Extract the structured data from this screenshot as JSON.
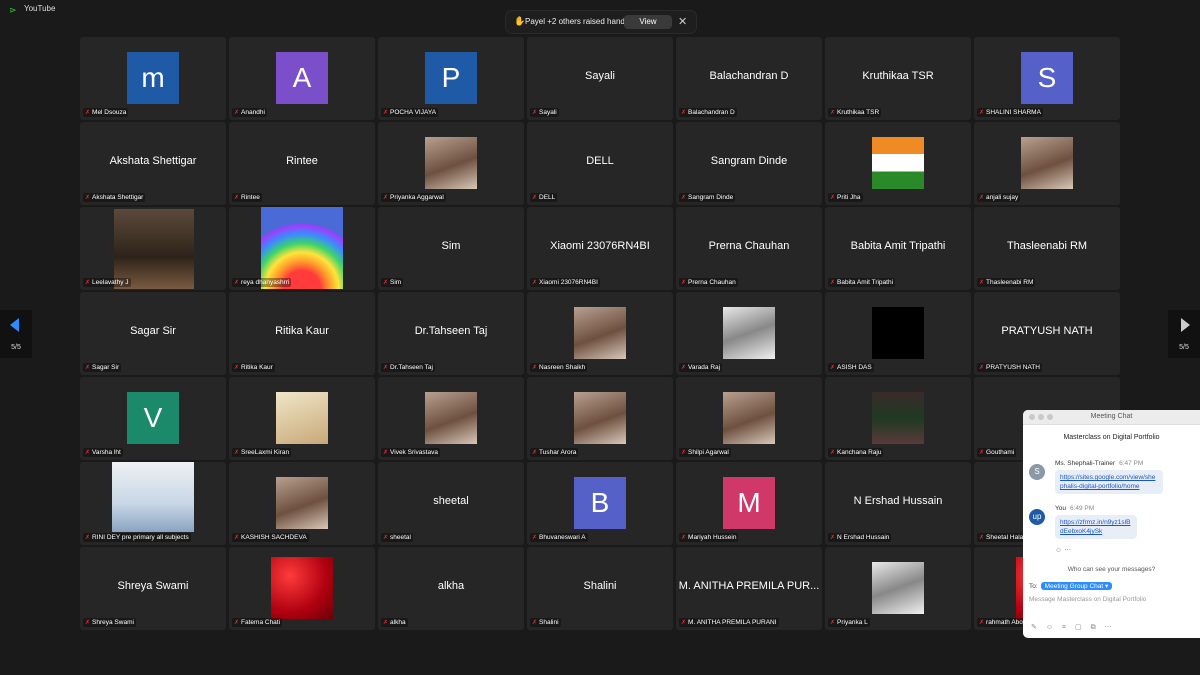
{
  "app": {
    "title": "YouTube",
    "icon": "app-icon"
  },
  "notification": {
    "text": "Payel +2 others raised hands",
    "view_label": "View",
    "close_glyph": "✕"
  },
  "navigation": {
    "prev_page": "5/5",
    "next_page": "5/5"
  },
  "participants": [
    {
      "big": "",
      "avatar": "m",
      "color": "#1f5aa6",
      "label": "Mel Dsouza"
    },
    {
      "big": "",
      "avatar": "A",
      "color": "#7b4fc9",
      "label": "Anandhi"
    },
    {
      "big": "",
      "avatar": "P",
      "color": "#1f5aa6",
      "label": "POCHA VIJAYA"
    },
    {
      "big": "Sayali",
      "label": "Sayali"
    },
    {
      "big": "Balachandran D",
      "label": "Balachandran D"
    },
    {
      "big": "Kruthikaa TSR",
      "label": "Kruthikaa TSR"
    },
    {
      "big": "",
      "avatar": "S",
      "color": "#5560c8",
      "label": "SHALINI SHARMA"
    },
    {
      "big": "Akshata Shettigar",
      "label": "Akshata Shettigar"
    },
    {
      "big": "Rintee",
      "label": "Rintee"
    },
    {
      "big": "",
      "photo": "person",
      "label": "Priyanka Aggarwal"
    },
    {
      "big": "DELL",
      "label": "DELL"
    },
    {
      "big": "Sangram Dinde",
      "label": "Sangram Dinde"
    },
    {
      "big": "",
      "photo": "flag",
      "label": "Priti Jha"
    },
    {
      "big": "",
      "photo": "person",
      "label": "anjali sujay"
    },
    {
      "big": "",
      "photo": "person-wide",
      "label": "Leelavathy J"
    },
    {
      "big": "",
      "photo": "rainbow",
      "label": "reya dhanyashrri"
    },
    {
      "big": "Sim",
      "label": "Sim"
    },
    {
      "big": "Xiaomi 23076RN4BI",
      "label": "Xiaomi 23076RN4BI"
    },
    {
      "big": "Prerna Chauhan",
      "label": "Prerna Chauhan"
    },
    {
      "big": "Babita Amit Tripathi",
      "label": "Babita Amit Tripathi"
    },
    {
      "big": "Thasleenabi RM",
      "label": "Thasleenabi RM"
    },
    {
      "big": "Sagar Sir",
      "label": "Sagar Sir"
    },
    {
      "big": "Ritika Kaur",
      "label": "Ritika Kaur"
    },
    {
      "big": "Dr.Tahseen Taj",
      "label": "Dr.Tahseen Taj"
    },
    {
      "big": "",
      "photo": "person",
      "label": "Nasreen Shaikh"
    },
    {
      "big": "",
      "photo": "person-light",
      "label": "Varada Raj"
    },
    {
      "big": "",
      "photo": "black",
      "label": "ASISH DAS"
    },
    {
      "big": "PRATYUSH NATH",
      "label": "PRATYUSH NATH"
    },
    {
      "big": "",
      "avatar": "V",
      "color": "#1a8a6a",
      "label": "Varsha lht"
    },
    {
      "big": "",
      "photo": "logo",
      "label": "SreeLaxmi Kiran"
    },
    {
      "big": "",
      "photo": "person",
      "label": "Vivek Srivastava"
    },
    {
      "big": "",
      "photo": "person",
      "label": "Tushar Arora"
    },
    {
      "big": "",
      "photo": "person",
      "label": "Shilpi Agarwal"
    },
    {
      "big": "",
      "photo": "tree",
      "label": "Kanchana Raju"
    },
    {
      "big": "",
      "label": "Gouthami"
    },
    {
      "big": "",
      "photo": "inner-peace",
      "label": "RINI DEY pre primary all subjects"
    },
    {
      "big": "",
      "photo": "person",
      "label": "KASHISH SACHDEVA"
    },
    {
      "big": "sheetal",
      "label": "sheetal"
    },
    {
      "big": "",
      "avatar": "B",
      "color": "#5560c8",
      "label": "Bhuvaneswari A"
    },
    {
      "big": "",
      "avatar": "M",
      "color": "#d0386a",
      "label": "Mariyah Hussein"
    },
    {
      "big": "N Ershad Hussain",
      "label": "N Ershad Hussain"
    },
    {
      "big": "She",
      "label": "Sheetal Hala"
    },
    {
      "big": "Shreya Swami",
      "label": "Shreya Swami"
    },
    {
      "big": "",
      "photo": "roses",
      "label": "Fatema Chati"
    },
    {
      "big": "alkha",
      "label": "alkha"
    },
    {
      "big": "Shalini",
      "label": "Shalini"
    },
    {
      "big": "M. ANITHA PREMILA PUR...",
      "label": "M. ANITHA PREMILA PURANI"
    },
    {
      "big": "",
      "photo": "person-light",
      "label": "Priyanka L"
    },
    {
      "big": "",
      "photo": "roses",
      "label": "rahmath Abo"
    }
  ],
  "chat": {
    "window_title": "Meeting Chat",
    "meeting_name": "Masterclass on Digital Portfolio",
    "messages": [
      {
        "sender": "Ms. Shephali-Trainer",
        "time": "6:47 PM",
        "avatar": "S",
        "avatar_color": "#8b98a6",
        "text": "https://sites.google.com/view/shephalis-digital-portfolio/home"
      },
      {
        "sender": "You",
        "time": "6:49 PM",
        "avatar": "up",
        "avatar_color": "#1f5aa6",
        "text": "https://zfrmz.in/n9yz1slBdEebxoK4jySk"
      }
    ],
    "who_can_see": "Who can see your messages?",
    "to_label": "To:",
    "recipient": "Meeting Group Chat ▾",
    "input_placeholder": "Message Masterclass on Digital Portfolio"
  },
  "colors": {
    "tile_bg": "#262626",
    "mic_muted": "#e03030",
    "chat_link": "#1a56c8",
    "accent": "#2d8cff"
  }
}
